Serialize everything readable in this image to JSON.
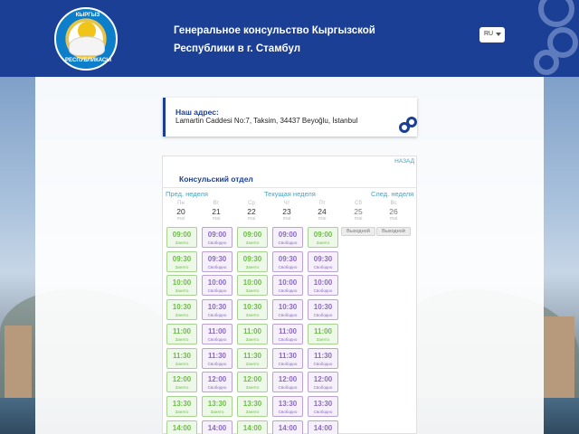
{
  "header": {
    "title_line1": "Генеральное консульство Кыргызской",
    "title_line2": "Республики в г. Стамбул",
    "emblem_top": "КЫРГЫЗ",
    "emblem_bottom": "РЕСПУБЛИКАСЫ",
    "language": "RU"
  },
  "address": {
    "label": "Наш адрес:",
    "value": "Lamartin Caddesi No:7, Taksim, 34437 Beyoğlu, İstanbul"
  },
  "panel": {
    "back": "НАЗАД",
    "department": "Консульский отдел",
    "prev_week": "Пред. неделя",
    "current_week": "Текущая неделя",
    "next_week": "След. неделя",
    "days": [
      {
        "dow": "Пн",
        "date": "20",
        "month": "mai"
      },
      {
        "dow": "Вт",
        "date": "21",
        "month": "mai"
      },
      {
        "dow": "Ср",
        "date": "22",
        "month": "mai"
      },
      {
        "dow": "Чт",
        "date": "23",
        "month": "mai"
      },
      {
        "dow": "Пт",
        "date": "24",
        "month": "mai"
      },
      {
        "dow": "Сб",
        "date": "25",
        "month": "mai"
      },
      {
        "dow": "Вс",
        "date": "26",
        "month": "mai"
      }
    ],
    "day_off_label": "Выходной",
    "busy_label": "Занято",
    "free_label": "Свободно",
    "rows": [
      {
        "time": "09:00",
        "status": [
          "busy",
          "free",
          "busy",
          "free",
          "busy"
        ]
      },
      {
        "time": "09:30",
        "status": [
          "busy",
          "free",
          "busy",
          "free",
          "free"
        ]
      },
      {
        "time": "10:00",
        "status": [
          "busy",
          "free",
          "busy",
          "free",
          "free"
        ]
      },
      {
        "time": "10:30",
        "status": [
          "busy",
          "free",
          "busy",
          "free",
          "free"
        ]
      },
      {
        "time": "11:00",
        "status": [
          "busy",
          "free",
          "busy",
          "free",
          "busy"
        ]
      },
      {
        "time": "11:30",
        "status": [
          "busy",
          "free",
          "busy",
          "free",
          "free"
        ]
      },
      {
        "time": "12:00",
        "status": [
          "busy",
          "free",
          "busy",
          "free",
          "free"
        ]
      },
      {
        "time": "13:30",
        "status": [
          "busy",
          "busy",
          "busy",
          "free",
          "free"
        ]
      },
      {
        "time": "14:00",
        "status": [
          "busy",
          "free",
          "busy",
          "free",
          "free"
        ]
      }
    ]
  },
  "colors": {
    "header_bg": "#1b3f94",
    "busy": "#6bbf45",
    "free": "#8a6bbf",
    "link": "#4aa0bf"
  }
}
